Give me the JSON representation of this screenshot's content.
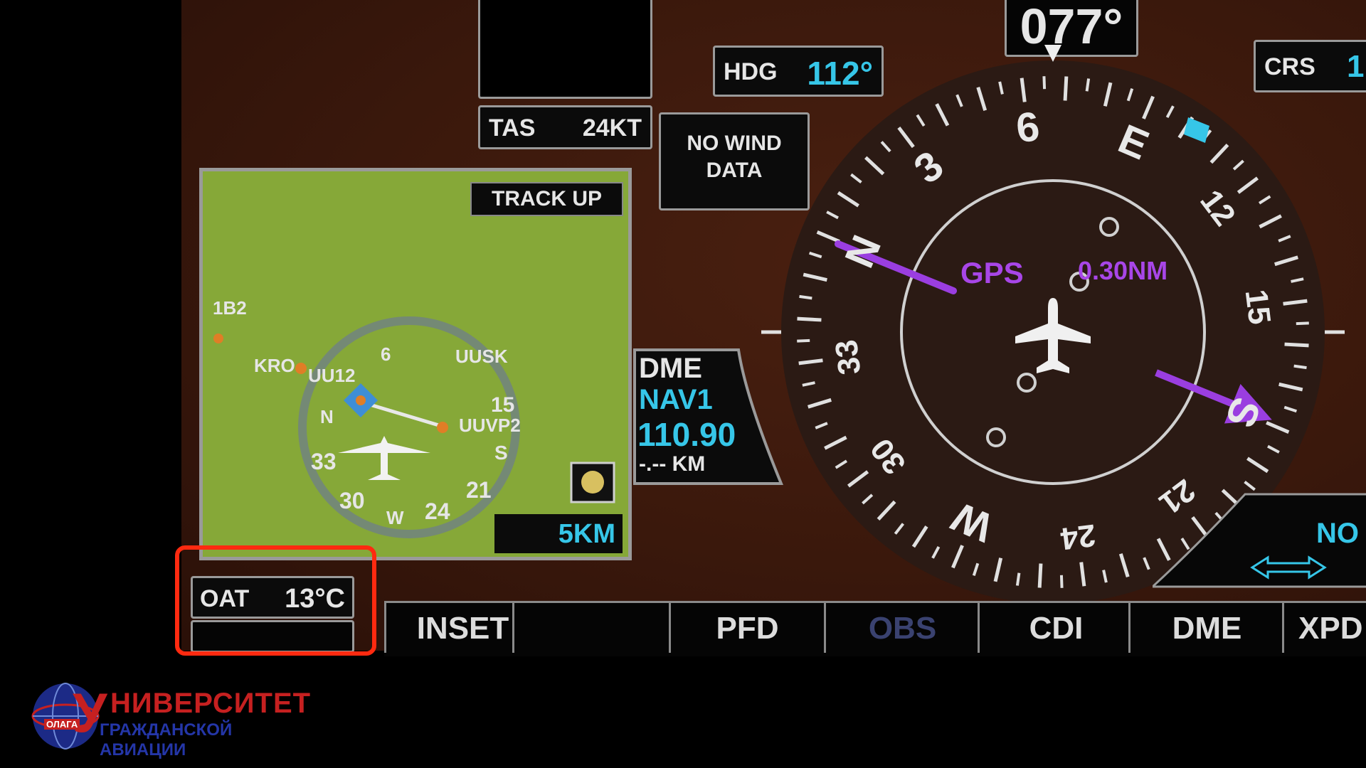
{
  "heading_readout": "077°",
  "hdg": {
    "label": "HDG",
    "value": "112°"
  },
  "crs": {
    "label": "CRS",
    "value": "1"
  },
  "tas": {
    "label": "TAS",
    "value": "24KT"
  },
  "wind": {
    "line1": "NO WIND",
    "line2": "DATA"
  },
  "inset_map": {
    "orientation": "TRACK UP",
    "range": "5KM",
    "waypoints": [
      "1B2",
      "KRO",
      "UUSK",
      "UU12",
      "UUVP2"
    ],
    "compass_labels": [
      "N",
      "33",
      "30",
      "W",
      "24",
      "21",
      "15",
      "S",
      "6"
    ]
  },
  "dme": {
    "title": "DME",
    "source": "NAV1",
    "freq": "110.90",
    "dist": "-.-- KM"
  },
  "hsi": {
    "labels": [
      "N",
      "3",
      "6",
      "E",
      "12",
      "15",
      "S",
      "21",
      "24",
      "W",
      "30",
      "33"
    ],
    "nav_source": "GPS",
    "distance": "0.30NM",
    "no_label": "NO"
  },
  "oat": {
    "label": "OAT",
    "value": "13°C"
  },
  "softkeys": [
    "INSET",
    "",
    "PFD",
    "OBS",
    "CDI",
    "DME",
    "XPD"
  ],
  "logo": {
    "line1": "НИВЕРСИТЕТ",
    "initial": "У",
    "line2": "ГРАЖДАНСКОЙ АВИАЦИИ",
    "ring": "ОЛАГА"
  },
  "colors": {
    "cyan": "#36c6e8",
    "magenta": "#a846e8",
    "highlight": "#ff2a10",
    "map_bg": "#86a838"
  }
}
